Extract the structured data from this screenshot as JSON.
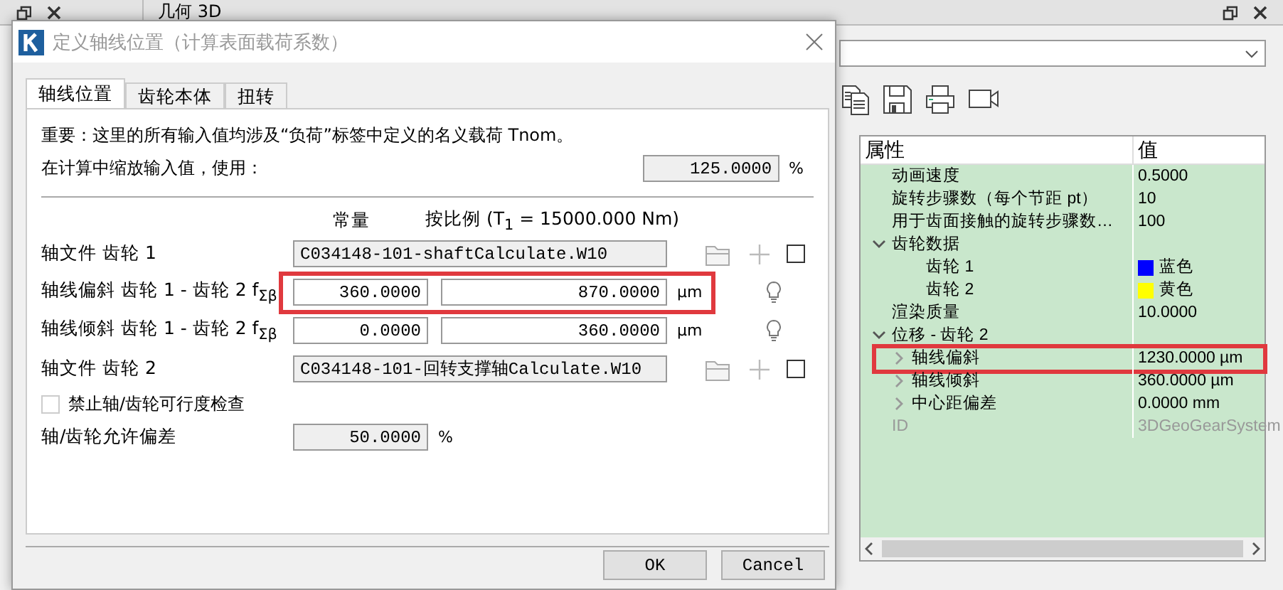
{
  "app": {
    "pane_title": "几何 3D"
  },
  "dialog": {
    "title": "定义轴线位置（计算表面载荷系数）",
    "tabs": [
      {
        "label": "轴线位置",
        "selected": true
      },
      {
        "label": "齿轮本体",
        "selected": false
      },
      {
        "label": "扭转",
        "selected": false
      }
    ],
    "note": "重要：这里的所有输入值均涉及“负荷”标签中定义的名义载荷 Tnom。",
    "scale": {
      "label": "在计算中缩放输入值，使用：",
      "value": "125.0000",
      "unit": "%"
    },
    "column_headers": [
      "常量",
      "按比例 (T$_{1}$ = 15000.000 Nm)"
    ],
    "rows": [
      {
        "kind": "file",
        "label": "轴文件 齿轮 1",
        "value": "C034148-101-shaftCalculate.W10",
        "checked": false,
        "highlighted": false
      },
      {
        "kind": "pair",
        "label": "轴线偏斜 齿轮 1 - 齿轮 2 f$_{Σβ}$",
        "constant": "360.0000",
        "proportional": "870.0000",
        "unit": "µm",
        "highlighted": true
      },
      {
        "kind": "pair",
        "label": "轴线倾斜 齿轮 1 - 齿轮 2 f$_{Σβ}$",
        "constant": "0.0000",
        "proportional": "360.0000",
        "unit": "µm",
        "highlighted": false
      },
      {
        "kind": "file",
        "label": "轴文件 齿轮 2",
        "value": "C034148-101-回转支撑轴Calculate.W10",
        "checked": false,
        "highlighted": false
      }
    ],
    "check": {
      "label": "禁止轴/齿轮可行度检查",
      "checked": false
    },
    "tolerance": {
      "label": "轴/齿轮允许偏差",
      "value": "50.0000",
      "unit": "%"
    },
    "buttons": [
      "OK",
      "Cancel"
    ]
  },
  "properties": {
    "columns": [
      "属性",
      "值"
    ],
    "rows": [
      {
        "label": "动画速度",
        "value": "0.5000",
        "disabled": false
      },
      {
        "label": "旋转步骤数（每个节距 pt）",
        "value": "10",
        "disabled": false
      },
      {
        "label": "用于齿面接触的旋转步骤数…",
        "value": "100",
        "disabled": false
      },
      {
        "label": "齿轮数据",
        "expanded": true,
        "disabled": false,
        "children": [
          {
            "label": "齿轮 1",
            "value": "蓝色",
            "color": "#0000ff"
          },
          {
            "label": "齿轮 2",
            "value": "黄色",
            "color": "#ffff00"
          }
        ]
      },
      {
        "label": "渲染质量",
        "value": "10.0000",
        "disabled": false
      },
      {
        "label": "位移 - 齿轮 2",
        "expanded": true,
        "disabled": false,
        "children": [
          {
            "label": "轴线偏斜",
            "value": "1230.0000 µm",
            "expanded": false,
            "highlighted": true
          },
          {
            "label": "轴线倾斜",
            "value": "360.0000 µm",
            "expanded": false,
            "highlighted": false
          },
          {
            "label": "中心距偏差",
            "value": "0.0000 mm",
            "expanded": false,
            "highlighted": false
          }
        ]
      },
      {
        "label": "ID",
        "value": "3DGeoGearSystem",
        "disabled": true
      }
    ]
  }
}
